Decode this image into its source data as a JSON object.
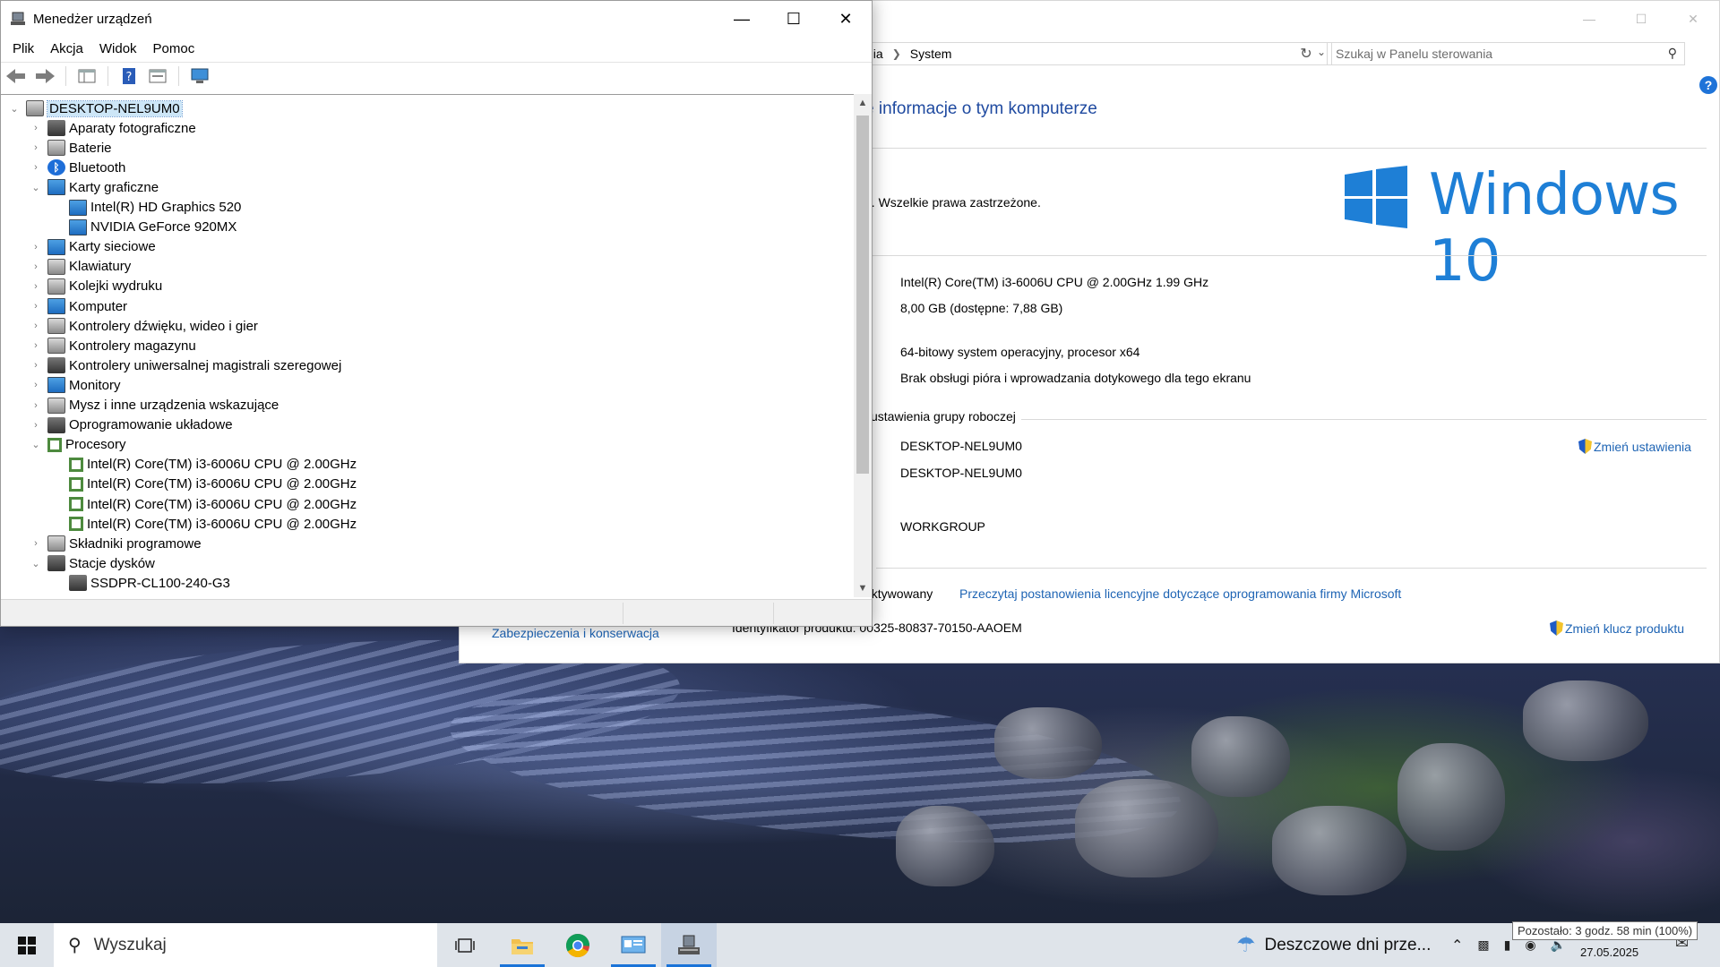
{
  "device_manager": {
    "title": "Menedżer urządzeń",
    "menu": [
      "Plik",
      "Akcja",
      "Widok",
      "Pomoc"
    ],
    "tree": [
      {
        "label": "DESKTOP-NEL9UM0",
        "level": 0,
        "expanded": true,
        "icon": "computer-icon",
        "selected": true
      },
      {
        "label": "Aparaty fotograficzne",
        "level": 1,
        "expanded": false,
        "icon": "camera-icon"
      },
      {
        "label": "Baterie",
        "level": 1,
        "expanded": false,
        "icon": "battery-icon"
      },
      {
        "label": "Bluetooth",
        "level": 1,
        "expanded": false,
        "icon": "bluetooth-icon"
      },
      {
        "label": "Karty graficzne",
        "level": 1,
        "expanded": true,
        "icon": "display-adapter-icon"
      },
      {
        "label": "Intel(R) HD Graphics 520",
        "level": 2,
        "icon": "display-adapter-icon"
      },
      {
        "label": "NVIDIA GeForce 920MX",
        "level": 2,
        "icon": "display-adapter-icon"
      },
      {
        "label": "Karty sieciowe",
        "level": 1,
        "expanded": false,
        "icon": "network-adapter-icon"
      },
      {
        "label": "Klawiatury",
        "level": 1,
        "expanded": false,
        "icon": "keyboard-icon"
      },
      {
        "label": "Kolejki wydruku",
        "level": 1,
        "expanded": false,
        "icon": "printer-icon"
      },
      {
        "label": "Komputer",
        "level": 1,
        "expanded": false,
        "icon": "monitor-icon"
      },
      {
        "label": "Kontrolery dźwięku, wideo i gier",
        "level": 1,
        "expanded": false,
        "icon": "speaker-icon"
      },
      {
        "label": "Kontrolery magazynu",
        "level": 1,
        "expanded": false,
        "icon": "storage-controller-icon"
      },
      {
        "label": "Kontrolery uniwersalnej magistrali szeregowej",
        "level": 1,
        "expanded": false,
        "icon": "usb-icon"
      },
      {
        "label": "Monitory",
        "level": 1,
        "expanded": false,
        "icon": "monitor-icon"
      },
      {
        "label": "Mysz i inne urządzenia wskazujące",
        "level": 1,
        "expanded": false,
        "icon": "mouse-icon"
      },
      {
        "label": "Oprogramowanie układowe",
        "level": 1,
        "expanded": false,
        "icon": "firmware-icon"
      },
      {
        "label": "Procesory",
        "level": 1,
        "expanded": true,
        "icon": "cpu-icon"
      },
      {
        "label": "Intel(R) Core(TM) i3-6006U CPU @ 2.00GHz",
        "level": 2,
        "icon": "cpu-icon"
      },
      {
        "label": "Intel(R) Core(TM) i3-6006U CPU @ 2.00GHz",
        "level": 2,
        "icon": "cpu-icon"
      },
      {
        "label": "Intel(R) Core(TM) i3-6006U CPU @ 2.00GHz",
        "level": 2,
        "icon": "cpu-icon"
      },
      {
        "label": "Intel(R) Core(TM) i3-6006U CPU @ 2.00GHz",
        "level": 2,
        "icon": "cpu-icon"
      },
      {
        "label": "Składniki programowe",
        "level": 1,
        "expanded": false,
        "icon": "software-component-icon"
      },
      {
        "label": "Stacje dysków",
        "level": 1,
        "expanded": true,
        "icon": "disk-drive-icon"
      },
      {
        "label": "SSDPR-CL100-240-G3",
        "level": 2,
        "icon": "disk-drive-icon"
      }
    ]
  },
  "control_panel": {
    "breadcrumb": [
      "nia",
      "System"
    ],
    "search_placeholder": "Szukaj w Panelu sterowania",
    "heading": "e informacje o tym komputerze",
    "copyright": "n. Wszelkie prawa zastrzeżone.",
    "windows_logo_text": "Windows 10",
    "processor": "Intel(R) Core(TM) i3-6006U CPU @ 2.00GHz   1.99 GHz",
    "ram": "8,00 GB (dostępne: 7,88 GB)",
    "system_type": "64-bitowy system operacyjny, procesor x64",
    "pen_touch": "Brak obsługi pióra i wprowadzania dotykowego dla tego ekranu",
    "workgroup_section": "i ustawienia grupy roboczej",
    "computer_name": "DESKTOP-NEL9UM0",
    "full_name_colon": ":",
    "full_name": "DESKTOP-NEL9UM0",
    "workgroup": "WORKGROUP",
    "change_settings": "Zmień ustawienia",
    "activation_section": "s",
    "activated": "aktywowany",
    "license_link": "Przeczytaj postanowienia licencyjne dotyczące oprogramowania firmy Microsoft",
    "product_id": "Identyfikator produktu: 00325-80837-70150-AAOEM",
    "change_key": "Zmień klucz produktu",
    "security_link": "Zabezpieczenia i konserwacja"
  },
  "taskbar": {
    "search_placeholder": "Wyszukaj",
    "weather": "Deszczowe dni prze...",
    "date": "27.05.2025",
    "battery_tooltip": "Pozostało: 3 godz. 58 min (100%)"
  },
  "colors": {
    "link": "#1e64b4",
    "heading": "#1f4aa0",
    "windows_blue": "#1e7fd6",
    "selection": "#cde6f7"
  }
}
